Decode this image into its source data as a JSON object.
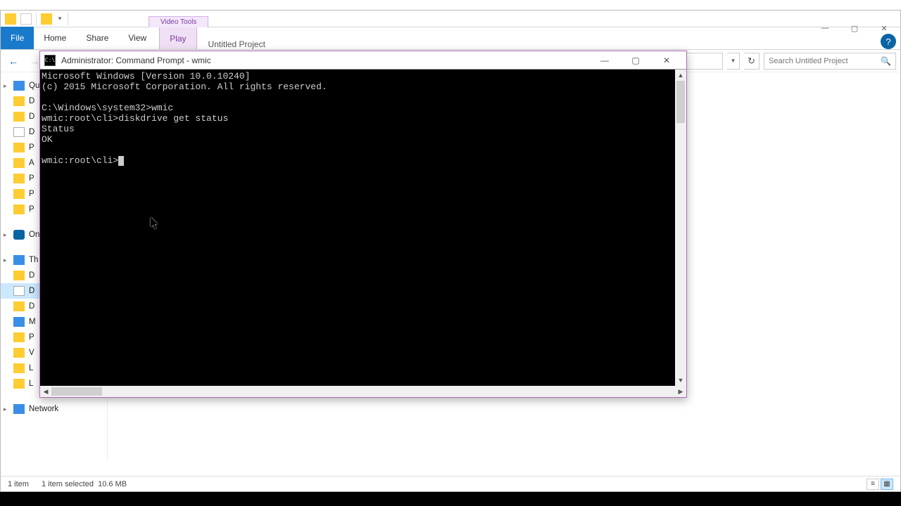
{
  "explorer": {
    "group_header": "Video Tools",
    "window_title": "Untitled Project",
    "tabs": {
      "file": "File",
      "home": "Home",
      "share": "Share",
      "view": "View",
      "play": "Play"
    },
    "search_placeholder": "Search Untitled Project",
    "nav": [
      {
        "label": "Qu",
        "icon": "blue",
        "section": true
      },
      {
        "label": "D",
        "icon": "yellow"
      },
      {
        "label": "D",
        "icon": "yellow"
      },
      {
        "label": "D",
        "icon": "doc"
      },
      {
        "label": "P",
        "icon": "yellow"
      },
      {
        "label": "A",
        "icon": "yellow"
      },
      {
        "label": "P",
        "icon": "yellow"
      },
      {
        "label": "P",
        "icon": "yellow"
      },
      {
        "label": "P",
        "icon": "yellow"
      },
      {
        "label": "",
        "icon": ""
      },
      {
        "label": "On",
        "icon": "cloud",
        "section": true
      },
      {
        "label": "",
        "icon": ""
      },
      {
        "label": "Th",
        "icon": "pc",
        "section": true
      },
      {
        "label": "D",
        "icon": "yellow"
      },
      {
        "label": "D",
        "icon": "doc",
        "selected": true
      },
      {
        "label": "D",
        "icon": "yellow"
      },
      {
        "label": "M",
        "icon": "music"
      },
      {
        "label": "P",
        "icon": "yellow"
      },
      {
        "label": "V",
        "icon": "yellow"
      },
      {
        "label": "L",
        "icon": "yellow"
      },
      {
        "label": "L",
        "icon": "yellow"
      },
      {
        "label": "",
        "icon": ""
      },
      {
        "label": "Network",
        "icon": "netw",
        "section": true,
        "net": true
      }
    ],
    "status": {
      "count": "1 item",
      "selected": "1 item selected",
      "size": "10.6 MB"
    }
  },
  "cmd": {
    "title": "Administrator: Command Prompt - wmic",
    "lines": [
      "Microsoft Windows [Version 10.0.10240]",
      "(c) 2015 Microsoft Corporation. All rights reserved.",
      "",
      "C:\\Windows\\system32>wmic",
      "wmic:root\\cli>diskdrive get status",
      "Status",
      "OK",
      "",
      "wmic:root\\cli>"
    ]
  }
}
